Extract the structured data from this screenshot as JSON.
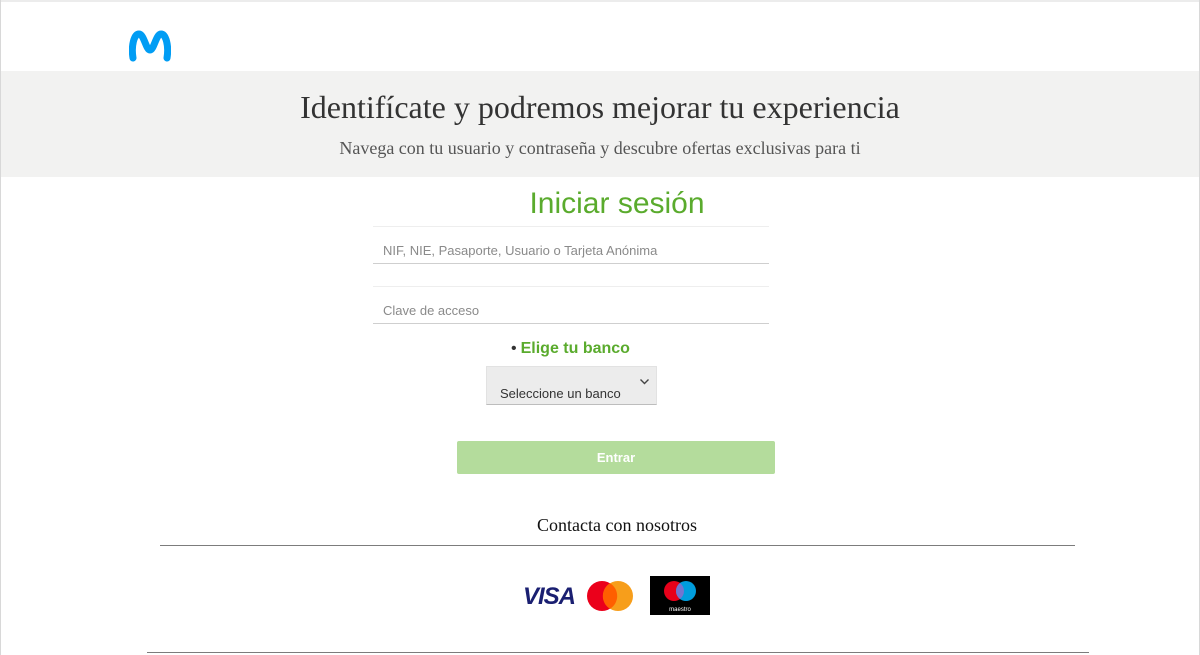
{
  "brand": {
    "logo_icon": "movistar-m-icon",
    "accent": "#019DF4"
  },
  "hero": {
    "title": "Identifícate y podremos mejorar tu experiencia",
    "subtitle": "Navega con tu usuario y contraseña y descubre ofertas exclusivas para ti"
  },
  "login": {
    "title": "Iniciar sesión",
    "user_placeholder": "NIF, NIE, Pasaporte, Usuario o Tarjeta Anónima",
    "password_placeholder": "Clave de acceso",
    "bank_bullet": "•",
    "bank_label": "Elige tu banco",
    "bank_select_value": "Seleccione un banco",
    "submit_label": "Entrar",
    "accent": "#5AAB2D"
  },
  "footer": {
    "contact_label": "Contacta con nosotros",
    "visa_label": "VISA",
    "maestro_label": "maestro"
  }
}
